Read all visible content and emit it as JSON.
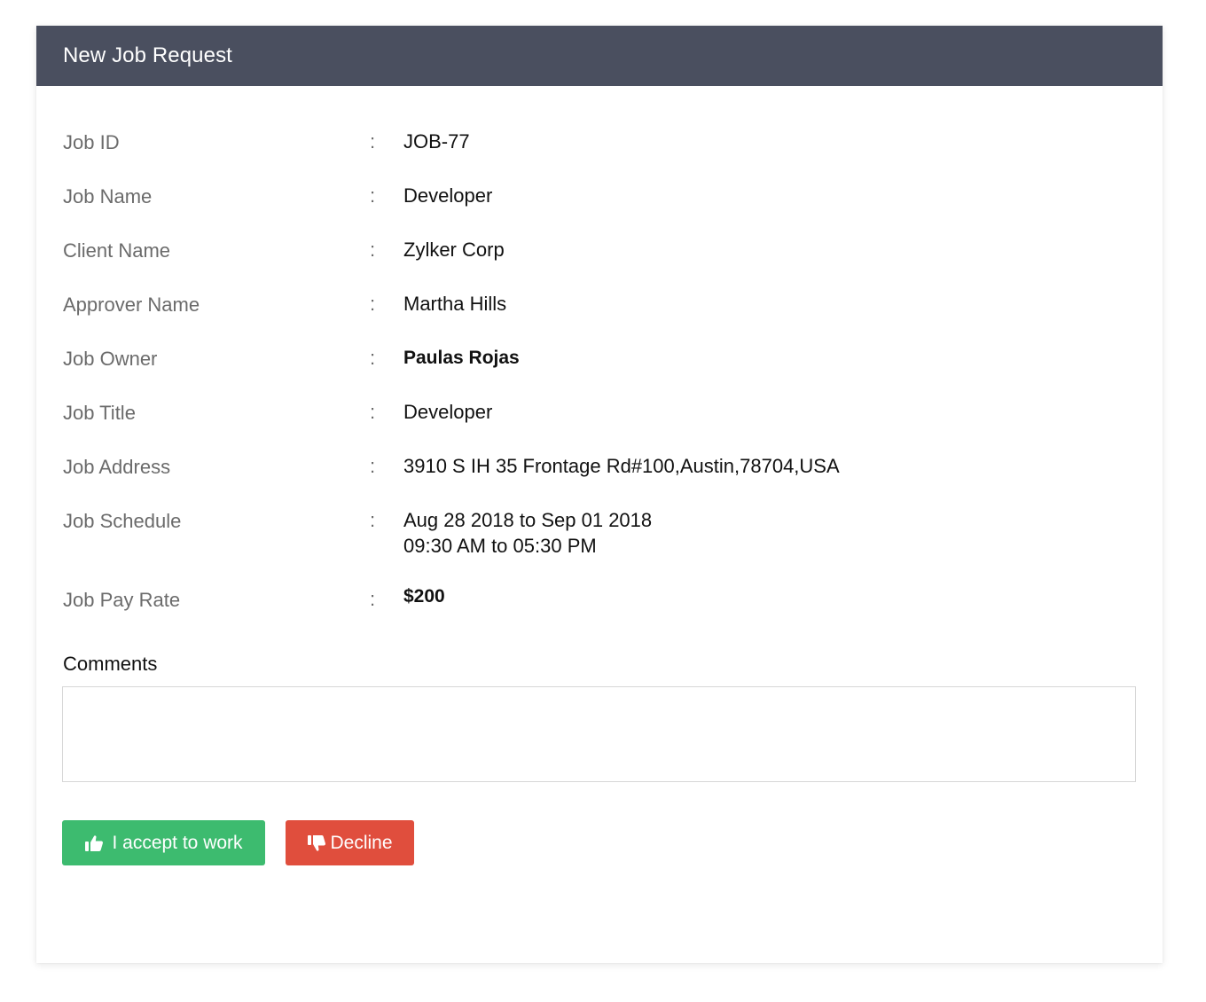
{
  "header": {
    "title": "New Job Request",
    "background_color": "#4a4f5f"
  },
  "details": {
    "separator": ":",
    "rows": [
      {
        "label": "Job ID",
        "value": "JOB-77"
      },
      {
        "label": "Job Name",
        "value": "Developer"
      },
      {
        "label": "Client Name",
        "value": "Zylker Corp"
      },
      {
        "label": "Approver Name",
        "value": "Martha Hills"
      },
      {
        "label": "Job Owner",
        "value": "Paulas Rojas"
      },
      {
        "label": "Job Title",
        "value": "Developer"
      },
      {
        "label": "Job Address",
        "value": "3910 S IH 35 Frontage Rd#100,Austin,78704,USA"
      },
      {
        "label": "Job Schedule",
        "value": "Aug 28 2018 to Sep 01 2018",
        "value_line2": "09:30 AM to 05:30 PM"
      },
      {
        "label": "Job Pay Rate",
        "value": "$200"
      }
    ]
  },
  "comments": {
    "label": "Comments",
    "value": "",
    "placeholder": ""
  },
  "actions": {
    "accept": {
      "label": "I accept to work",
      "icon": "thumbs-up-icon",
      "color": "#3dbb6f"
    },
    "decline": {
      "label": "Decline",
      "icon": "thumbs-down-icon",
      "color": "#e04e3d"
    }
  }
}
